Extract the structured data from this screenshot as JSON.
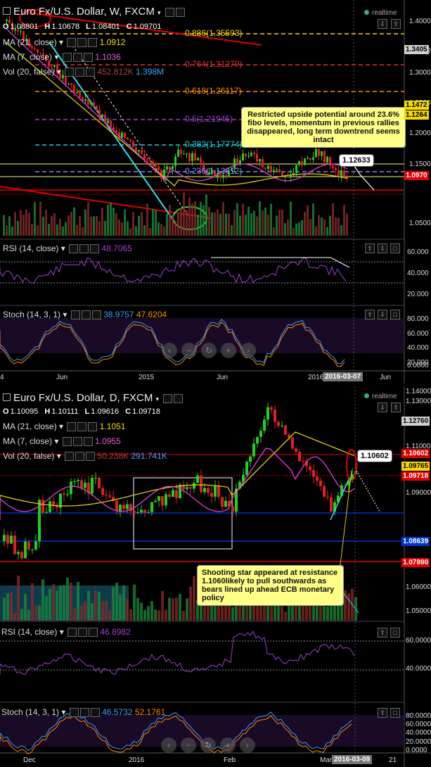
{
  "weekly": {
    "title": "Euro Fx/U.S. Dollar, W, FXCM",
    "realtime": "realtime",
    "ohlc": {
      "o": "1.08801",
      "h": "1.10678",
      "l": "1.08401",
      "c": "1.09701"
    },
    "ma21": {
      "label": "MA (21, close)",
      "value": "1.0912"
    },
    "ma7": {
      "label": "MA (7, close)",
      "value": "1.1036"
    },
    "vol": {
      "label": "Vol (20, false)",
      "v1": "452.812K",
      "v2": "1.398M"
    },
    "rsi": {
      "label": "RSI (14, close)",
      "value": "48.7065"
    },
    "stoch": {
      "label": "Stoch (14, 3, 1)",
      "v1": "38.9757",
      "v2": "47.6204"
    },
    "fib": [
      {
        "label": "0.886(1.35593)",
        "color": "#f5d800"
      },
      {
        "label": "0.764(1.31279)",
        "color": "#e03030"
      },
      {
        "label": "0.618(1.26117)",
        "color": "#ff8c00"
      },
      {
        "label": "0.5(1.21945)",
        "color": "#a040d0"
      },
      {
        "label": "0.382(1.17774)",
        "color": "#20d0e0"
      },
      {
        "label": "0.236(1.13612)",
        "color": "#8888ff"
      }
    ],
    "note": "Restricted upside potential around 23.6% fibo levels, momentum in previous rallies disappeared, long term downtrend seems intact",
    "callout": "1.12633",
    "price_axis": [
      "1.4000",
      "1.3500",
      "1.3000",
      "1.2500",
      "1.2000",
      "1.1500",
      "1.0500"
    ],
    "price_badges": [
      {
        "text": "1.3405",
        "bg": "#d0d0d0",
        "fg": "#000"
      },
      {
        "text": "1.1472",
        "bg": "#f5d800",
        "fg": "#000"
      },
      {
        "text": "1.1264",
        "bg": "#f5d800",
        "fg": "#000"
      },
      {
        "text": "1.0970",
        "bg": "#e00000",
        "fg": "#fff"
      }
    ],
    "rsi_axis": [
      "60.000",
      "40.000",
      "20.000"
    ],
    "stoch_axis": [
      "80.000",
      "60.000",
      "40.000",
      "20.000",
      "0.0000"
    ],
    "time_axis": [
      "4",
      "Jun",
      "2015",
      "Jun",
      "2016",
      "Jun"
    ],
    "date_badge": "2016-03-07"
  },
  "daily": {
    "title": "Euro Fx/U.S. Dollar, D, FXCM",
    "realtime": "realtime",
    "ohlc": {
      "o": "1.10095",
      "h": "1.10111",
      "l": "1.09616",
      "c": "1.09718"
    },
    "ma21": {
      "label": "MA (21, close)",
      "value": "1.1051"
    },
    "ma7": {
      "label": "MA (7, close)",
      "value": "1.0955"
    },
    "vol": {
      "label": "Vol (20, false)",
      "v1": "50.238K",
      "v2": "291.741K"
    },
    "rsi": {
      "label": "RSI (14, close)",
      "value": "46.8982"
    },
    "stoch": {
      "label": "Stoch (14, 3, 1)",
      "v1": "46.5732",
      "v2": "52.1761"
    },
    "note": "Shooting star appeared at resistance 1.1060likely to pull southwards as bears lined up ahead ECB monetary policy",
    "callout": "1.10602",
    "price_axis": [
      "1.14000",
      "1.13000",
      "1.11000",
      "1.09000",
      "1.06000",
      "1.05000"
    ],
    "price_badges": [
      {
        "text": "1.12760",
        "bg": "#d0d0d0",
        "fg": "#000"
      },
      {
        "text": "1.10602",
        "bg": "#e00000",
        "fg": "#fff"
      },
      {
        "text": "1.09765",
        "bg": "#f5d800",
        "fg": "#000"
      },
      {
        "text": "1.09718",
        "bg": "#e00000",
        "fg": "#fff"
      },
      {
        "text": "1.08639",
        "bg": "#0033cc",
        "fg": "#fff"
      },
      {
        "text": "1.07890",
        "bg": "#e00000",
        "fg": "#fff"
      }
    ],
    "rsi_axis": [
      "60.0000",
      "40.0000"
    ],
    "stoch_axis": [
      "80.0000",
      "60.0000",
      "40.0000",
      "20.0000",
      "0.0000"
    ],
    "time_axis": [
      "Dec",
      "2016",
      "Feb",
      "Mar",
      "21"
    ],
    "date_badge": "2016-03-09"
  }
}
